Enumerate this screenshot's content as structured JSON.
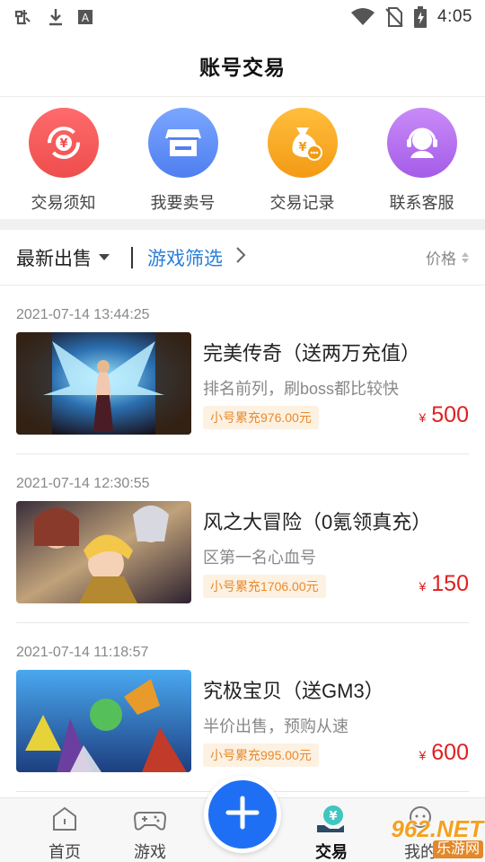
{
  "status_bar": {
    "time": "4:05",
    "icons": [
      "bug-icon",
      "download-icon",
      "font-a-icon",
      "wifi-icon",
      "no-sim-icon",
      "battery-charging-icon"
    ]
  },
  "header": {
    "title": "账号交易"
  },
  "quick_actions": [
    {
      "label": "交易须知",
      "icon": "exchange-yuan-icon",
      "color": "#f25c5c"
    },
    {
      "label": "我要卖号",
      "icon": "store-icon",
      "color": "#5b8df6"
    },
    {
      "label": "交易记录",
      "icon": "money-bag-icon",
      "color": "#f5a623"
    },
    {
      "label": "联系客服",
      "icon": "headset-icon",
      "color": "#b86cf0"
    }
  ],
  "filter_bar": {
    "latest_label": "最新出售",
    "game_filter_label": "游戏筛选",
    "price_label": "价格"
  },
  "listings": [
    {
      "time": "2021-07-14 13:44:25",
      "title": "完美传奇（送两万充值）",
      "desc": "排名前列，刷boss都比较快",
      "badge": "小号累充976.00元",
      "price_symbol": "¥",
      "price": "500"
    },
    {
      "time": "2021-07-14 12:30:55",
      "title": "风之大冒险（0氪领真充）",
      "desc": "区第一名心血号",
      "badge": "小号累充1706.00元",
      "price_symbol": "¥",
      "price": "150"
    },
    {
      "time": "2021-07-14 11:18:57",
      "title": "究极宝贝（送GM3）",
      "desc": "半价出售，预购从速",
      "badge": "小号累充995.00元",
      "price_symbol": "¥",
      "price": "600"
    }
  ],
  "bottom_nav": {
    "items": [
      {
        "label": "首页",
        "icon": "home-icon"
      },
      {
        "label": "游戏",
        "icon": "gamepad-icon"
      },
      {
        "label": "交易",
        "icon": "trade-icon",
        "active": true
      },
      {
        "label": "我的",
        "icon": "profile-icon"
      }
    ],
    "fab_icon": "plus-icon"
  },
  "watermark": {
    "number": "962.NET",
    "site": "乐游网"
  },
  "colors": {
    "accent_blue": "#2a7fd8",
    "fab_blue": "#1f6ff5",
    "price_red": "#e02020",
    "badge_orange": "#e88a2c"
  }
}
